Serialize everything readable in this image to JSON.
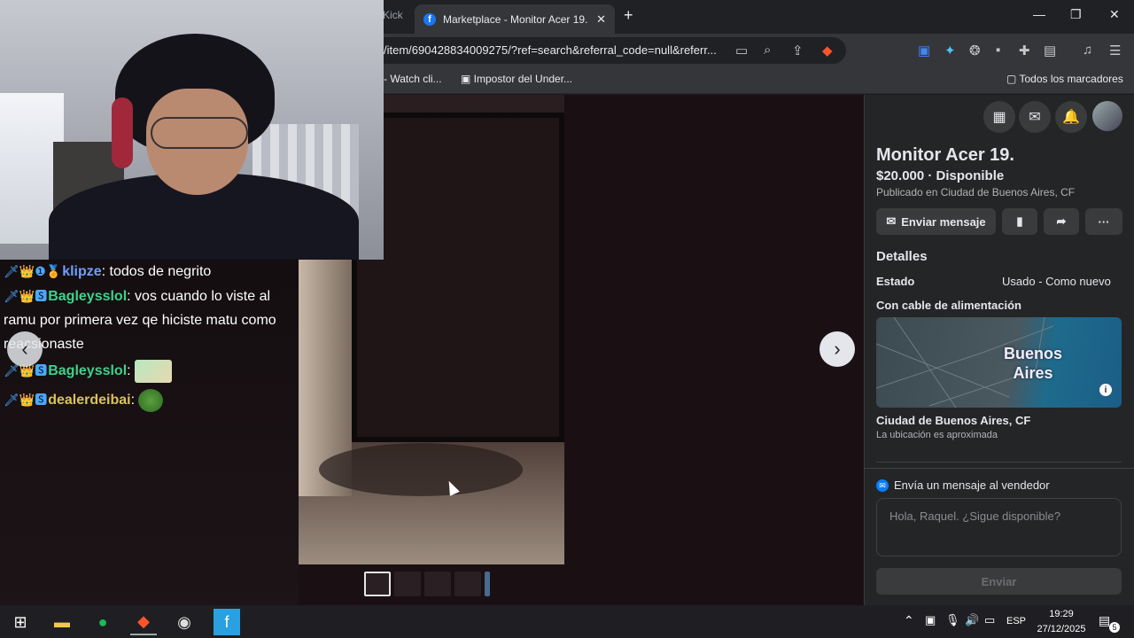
{
  "browser": {
    "prev_tab_label": "Kick",
    "active_tab_title": "Marketplace - Monitor Acer 19. |",
    "url": "/item/690428834009275/?ref=search&referral_code=null&referr...",
    "bookmarks": [
      {
        "label": "- Watch cli..."
      },
      {
        "label": "Impostor del Under..."
      }
    ],
    "all_bookmarks_label": "Todos los marcadores"
  },
  "listing": {
    "title": "Monitor Acer 19.",
    "price_status": "$20.000 · Disponible",
    "published": "Publicado en Ciudad de Buenos Aires, CF",
    "send_message_label": "Enviar mensaje",
    "details_title": "Detalles",
    "condition_label": "Estado",
    "condition_value": "Usado - Como nuevo",
    "description": "Con cable de alimentación",
    "map_city": "Buenos Aires",
    "location_name": "Ciudad de Buenos Aires, CF",
    "location_note": "La ubicación es aproximada",
    "message_seller_title": "Envía un mensaje al vendedor",
    "message_placeholder": "Hola, Raquel. ¿Sigue disponible?",
    "send_label": "Enviar"
  },
  "chat": {
    "messages": [
      {
        "user": "klipze",
        "text": "todos de negrito",
        "badges": "🗡👑❶🏅"
      },
      {
        "user": "Bagleysslol",
        "text": "vos cuando lo viste al ramu por primera vez qe hiciste matu como reacsionaste",
        "badges": "🗡👑🆂"
      },
      {
        "user": "Bagleysslol",
        "text": "",
        "badges": "🗡👑🆂"
      },
      {
        "user": "dealerdeibai",
        "text": "",
        "badges": "🗡👑🆂"
      }
    ]
  },
  "taskbar": {
    "lang": "ESP",
    "time": "19:29",
    "date": "27/12/2025",
    "notifications": "5"
  }
}
